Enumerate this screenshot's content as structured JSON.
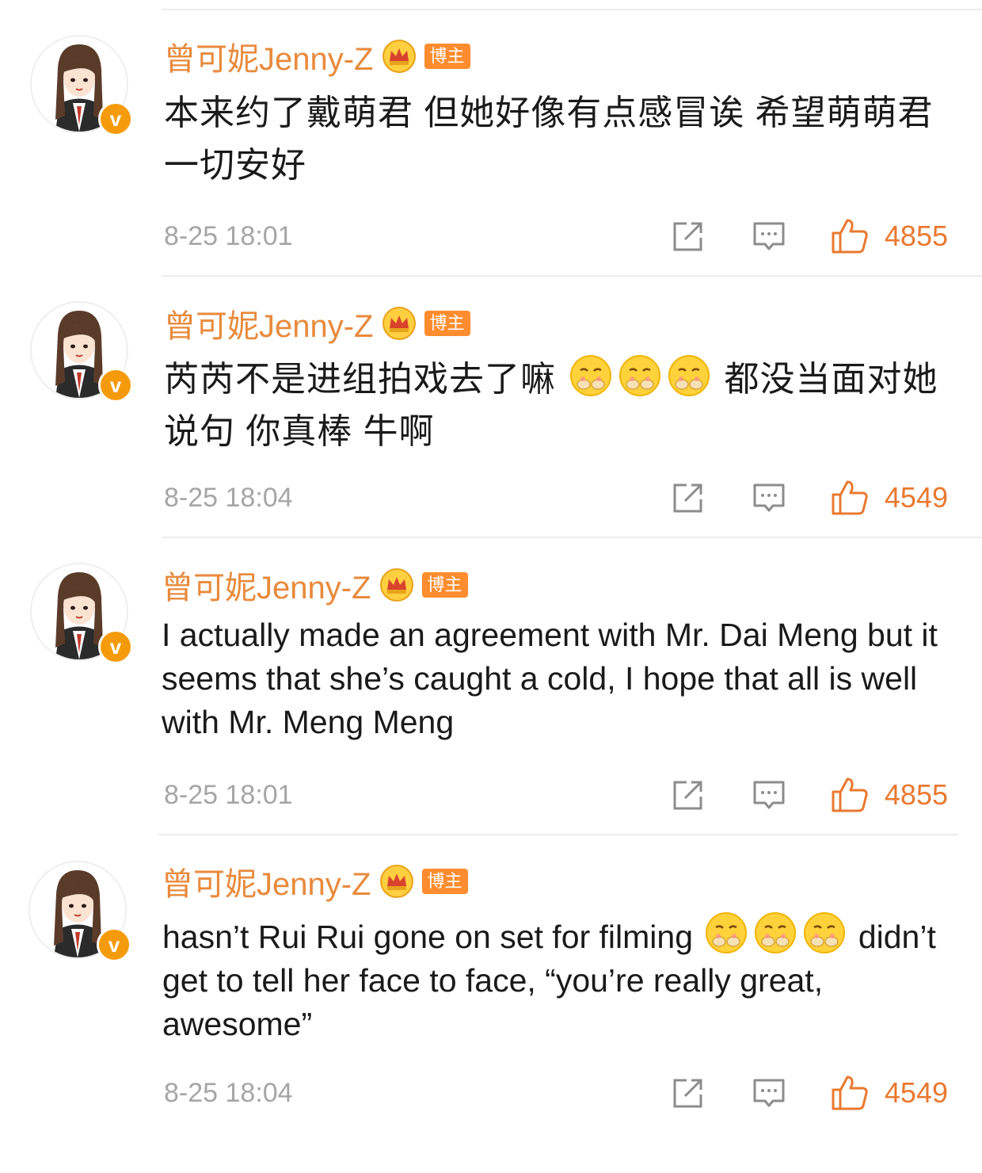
{
  "colors": {
    "username": "#e88a3c",
    "like_accent": "#e9792f",
    "tag_bg": "#ff8c2e",
    "verified_badge": "#f59b0b",
    "timestamp": "#a6a6a6"
  },
  "comments": [
    {
      "username": "曾可妮Jenny-Z",
      "tag": "博主",
      "verified_mark": "v",
      "text": "本来约了戴萌君 但她好像有点感冒诶 希望萌萌君一切安好",
      "text_after_emoji": "",
      "emoji_count": 0,
      "time": "8-25 18:01",
      "likes": "4855",
      "icons": [
        "share-icon",
        "comment-icon",
        "thumbs-up-icon"
      ]
    },
    {
      "username": "曾可妮Jenny-Z",
      "tag": "博主",
      "verified_mark": "v",
      "text": "芮芮不是进组拍戏去了嘛",
      "text_after_emoji": "都没当面对她说句 你真棒 牛啊",
      "emoji_count": 3,
      "time": "8-25 18:04",
      "likes": "4549",
      "icons": [
        "share-icon",
        "comment-icon",
        "thumbs-up-icon"
      ]
    },
    {
      "username": "曾可妮Jenny-Z",
      "tag": "博主",
      "verified_mark": "v",
      "text": "I actually made an agreement with Mr. Dai Meng but it seems that she’s caught a cold, I hope that all is well with Mr. Meng Meng",
      "text_after_emoji": "",
      "emoji_count": 0,
      "time": "8-25 18:01",
      "likes": "4855",
      "icons": [
        "share-icon",
        "comment-icon",
        "thumbs-up-icon"
      ]
    },
    {
      "username": "曾可妮Jenny-Z",
      "tag": "博主",
      "verified_mark": "v",
      "text": "hasn’t Rui Rui gone on set for filming",
      "text_after_emoji": "didn’t get to tell her face to face, “you’re really great, awesome”",
      "emoji_count": 3,
      "time": "8-25 18:04",
      "likes": "4549",
      "icons": [
        "share-icon",
        "comment-icon",
        "thumbs-up-icon"
      ]
    }
  ]
}
